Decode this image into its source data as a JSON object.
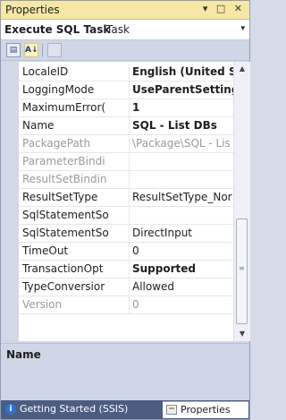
{
  "window": {
    "title": "Properties",
    "controls": "▾ □ ✕"
  },
  "object_selector": {
    "name": "Execute SQL Task",
    "type": "Task",
    "dropdown": "▾"
  },
  "toolbar": {
    "categorized_icon": "categorized-icon",
    "alphabetical_icon": "alphabetical-sort-icon",
    "alphabetical_label": "A↓",
    "property_pages_icon": "property-pages-icon"
  },
  "properties": [
    {
      "name": "LocaleID",
      "value": "English (United St",
      "value_bold": true,
      "disabled": false
    },
    {
      "name": "LoggingMode",
      "value": "UseParentSetting",
      "value_bold": true,
      "disabled": false
    },
    {
      "name": "MaximumError(",
      "value": "1",
      "value_bold": true,
      "disabled": false
    },
    {
      "name": "Name",
      "value": "SQL - List DBs",
      "value_bold": true,
      "disabled": false
    },
    {
      "name": "PackagePath",
      "value": "\\Package\\SQL - Lis",
      "value_bold": false,
      "disabled": true
    },
    {
      "name": "ParameterBindi",
      "value": "",
      "value_bold": false,
      "disabled": true
    },
    {
      "name": "ResultSetBindin",
      "value": "",
      "value_bold": false,
      "disabled": true
    },
    {
      "name": "ResultSetType",
      "value": "ResultSetType_Nor",
      "value_bold": false,
      "disabled": false
    },
    {
      "name": "SqlStatementSo",
      "value": "",
      "value_bold": false,
      "disabled": false
    },
    {
      "name": "SqlStatementSo",
      "value": "DirectInput",
      "value_bold": false,
      "disabled": false
    },
    {
      "name": "TimeOut",
      "value": "0",
      "value_bold": false,
      "disabled": false
    },
    {
      "name": "TransactionOpt",
      "value": "Supported",
      "value_bold": true,
      "disabled": false
    },
    {
      "name": "TypeConversior",
      "value": "Allowed",
      "value_bold": false,
      "disabled": false
    },
    {
      "name": "Version",
      "value": "0",
      "value_bold": false,
      "disabled": true
    }
  ],
  "scrollbar": {
    "up_arrow": "▲",
    "down_arrow": "▼",
    "grip": "≡"
  },
  "description": {
    "title": "Name",
    "text": ""
  },
  "tabs": [
    {
      "label": "Getting Started (SSIS)",
      "icon": "info-icon",
      "icon_glyph": "i",
      "active": false
    },
    {
      "label": "Properties",
      "icon": "properties-icon",
      "active": true
    }
  ],
  "colors": {
    "title_bar": "#f6e7a5",
    "tab_strip": "#4b5d80",
    "grid_gutter": "#d2d8e6",
    "disabled_text": "#9a9a9a"
  }
}
